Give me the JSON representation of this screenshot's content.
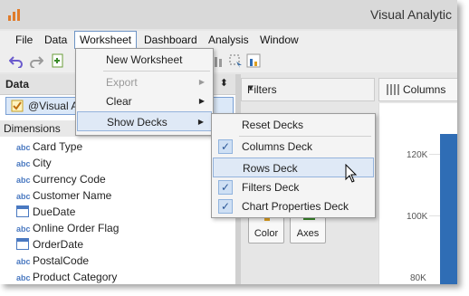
{
  "window": {
    "title": "Visual Analytic"
  },
  "menubar": {
    "items": [
      "File",
      "Data",
      "Worksheet",
      "Dashboard",
      "Analysis",
      "Window"
    ]
  },
  "data_panel": {
    "header": "Data",
    "source": "@Visual A",
    "dimensions_label": "Dimensions",
    "fields": [
      {
        "type": "abc",
        "name": "Card Type"
      },
      {
        "type": "abc",
        "name": "City"
      },
      {
        "type": "abc",
        "name": "Currency Code"
      },
      {
        "type": "abc",
        "name": "Customer Name"
      },
      {
        "type": "date",
        "name": "DueDate"
      },
      {
        "type": "abc",
        "name": "Online Order Flag"
      },
      {
        "type": "date",
        "name": "OrderDate"
      },
      {
        "type": "abc",
        "name": "PostalCode"
      },
      {
        "type": "abc",
        "name": "Product Category"
      }
    ]
  },
  "shelves": {
    "filters": "Filters",
    "columns": "Columns"
  },
  "marks": {
    "color": "Color",
    "axes": "Axes"
  },
  "chart": {
    "ticks": [
      "120K",
      "100K",
      "80K"
    ]
  },
  "worksheet_menu": {
    "items": [
      {
        "label": "New Worksheet",
        "disabled": false,
        "submenu": false
      },
      {
        "label": "Export",
        "disabled": true,
        "submenu": true
      },
      {
        "label": "Clear",
        "disabled": false,
        "submenu": true
      },
      {
        "label": "Show Decks",
        "disabled": false,
        "submenu": true,
        "highlighted": true
      }
    ]
  },
  "decks_menu": {
    "items": [
      {
        "label": "Reset Decks",
        "checked": false
      },
      {
        "label": "Columns Deck",
        "checked": true
      },
      {
        "label": "Rows Deck",
        "checked": false,
        "hovered": true
      },
      {
        "label": "Filters Deck",
        "checked": true
      },
      {
        "label": "Chart Properties Deck",
        "checked": true
      }
    ]
  },
  "colors": {
    "accent": "#2f6db5",
    "highlight": "#dfe9f6"
  }
}
